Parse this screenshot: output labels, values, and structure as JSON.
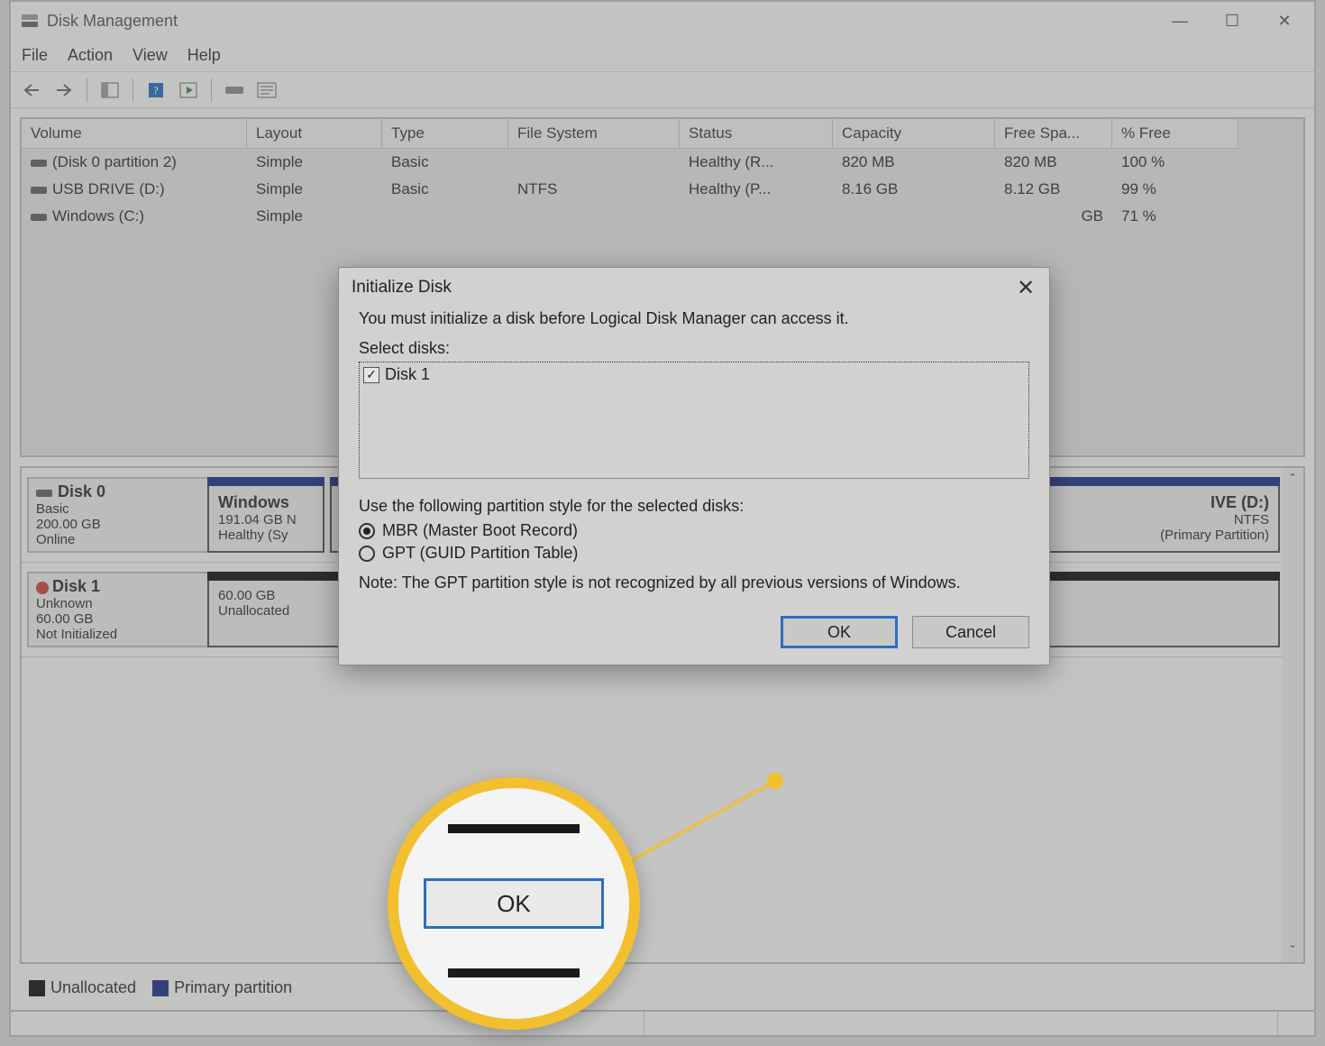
{
  "window": {
    "title": "Disk Management"
  },
  "menu": {
    "file": "File",
    "action": "Action",
    "view": "View",
    "help": "Help"
  },
  "columns": {
    "volume": "Volume",
    "layout": "Layout",
    "type": "Type",
    "fs": "File System",
    "status": "Status",
    "capacity": "Capacity",
    "free": "Free Spa...",
    "pct": "% Free"
  },
  "volumes": [
    {
      "name": "(Disk 0 partition 2)",
      "layout": "Simple",
      "type": "Basic",
      "fs": "",
      "status": "Healthy (R...",
      "capacity": "820 MB",
      "free": "820 MB",
      "pct": "100 %"
    },
    {
      "name": "USB DRIVE (D:)",
      "layout": "Simple",
      "type": "Basic",
      "fs": "NTFS",
      "status": "Healthy (P...",
      "capacity": "8.16 GB",
      "free": "8.12 GB",
      "pct": "99 %"
    },
    {
      "name": "Windows (C:)",
      "layout": "Simple",
      "type": "",
      "fs": "",
      "status": "",
      "capacity": "",
      "free": "GB",
      "pct": "71 %"
    }
  ],
  "disks": {
    "d0": {
      "name": "Disk 0",
      "type": "Basic",
      "size": "200.00 GB",
      "state": "Online",
      "p0": {
        "title": "Windows",
        "line2": "191.04 GB N",
        "line3": "Healthy (Sy"
      },
      "p1": {
        "title": "IVE (D:)",
        "line2": "NTFS",
        "line3": "(Primary Partition)"
      }
    },
    "d1": {
      "name": "Disk 1",
      "type": "Unknown",
      "size": "60.00 GB",
      "state": "Not Initialized",
      "p0": {
        "title": "",
        "line2": "60.00 GB",
        "line3": "Unallocated"
      }
    }
  },
  "legend": {
    "unalloc": "Unallocated",
    "primary": "Primary partition"
  },
  "dialog": {
    "title": "Initialize Disk",
    "instruction": "You must initialize a disk before Logical Disk Manager can access it.",
    "select_label": "Select disks:",
    "disk_item": "Disk 1",
    "style_label": "Use the following partition style for the selected disks:",
    "opt_mbr": "MBR (Master Boot Record)",
    "opt_gpt": "GPT (GUID Partition Table)",
    "note": "Note: The GPT partition style is not recognized by all previous versions of Windows.",
    "ok": "OK",
    "cancel": "Cancel"
  },
  "callout": {
    "ok": "OK"
  }
}
